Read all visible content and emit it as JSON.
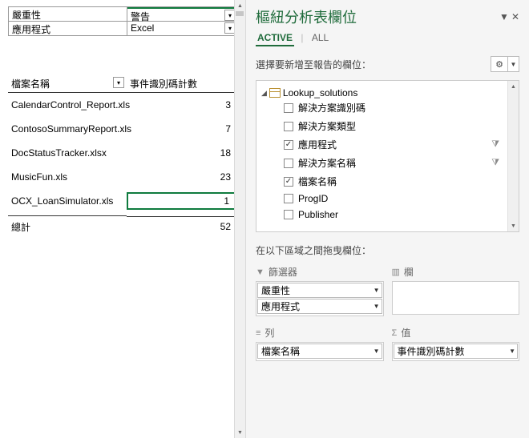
{
  "left": {
    "filters": [
      {
        "label": "嚴重性",
        "value": "警告"
      },
      {
        "label": "應用程式",
        "value": "Excel"
      }
    ],
    "header": {
      "rowLabel": "檔案名稱",
      "valLabel": "事件識別碼計數"
    },
    "rows": [
      {
        "name": "CalendarControl_Report.xls",
        "count": "3"
      },
      {
        "name": "ContosoSummaryReport.xls",
        "count": "7"
      },
      {
        "name": "DocStatusTracker.xlsx",
        "count": "18"
      },
      {
        "name": "MusicFun.xls",
        "count": "23"
      },
      {
        "name": "OCX_LoanSimulator.xls",
        "count": "1"
      }
    ],
    "total": {
      "label": "總計",
      "count": "52"
    }
  },
  "right": {
    "title": "樞紐分析表欄位",
    "tabs": {
      "active": "ACTIVE",
      "all": "ALL"
    },
    "prompt": "選擇要新增至報告的欄位：",
    "tree": {
      "root": "Lookup_solutions",
      "fields": [
        {
          "label": "解決方案識別碼",
          "checked": false,
          "filter": false
        },
        {
          "label": "解決方案類型",
          "checked": false,
          "filter": false
        },
        {
          "label": "應用程式",
          "checked": true,
          "filter": true
        },
        {
          "label": "解決方案名稱",
          "checked": false,
          "filter": true
        },
        {
          "label": "檔案名稱",
          "checked": true,
          "filter": false
        },
        {
          "label": "ProgID",
          "checked": false,
          "filter": false
        },
        {
          "label": "Publisher",
          "checked": false,
          "filter": false
        }
      ]
    },
    "dragPrompt": "在以下區域之間拖曳欄位：",
    "zones": {
      "filters": {
        "title": "篩選器",
        "items": [
          "嚴重性",
          "應用程式"
        ]
      },
      "columns": {
        "title": "欄",
        "items": []
      },
      "rows": {
        "title": "列",
        "items": [
          "檔案名稱"
        ]
      },
      "values": {
        "title": "值",
        "items": [
          "事件識別碼計數"
        ]
      }
    }
  }
}
